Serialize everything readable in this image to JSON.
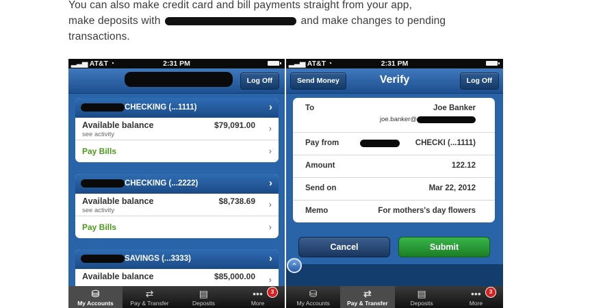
{
  "article": {
    "line1": "You can also make credit card and bill payments straight from your app,",
    "line2_before": "make deposits with",
    "line2_after": "and make changes to pending",
    "line3": "transactions."
  },
  "status_bar": {
    "carrier": "AT&T",
    "time": "2:31 PM"
  },
  "left_screen": {
    "logoff_label": "Log Off",
    "accounts": [
      {
        "name": "CHECKING (...1111)",
        "balance_label": "Available balance",
        "balance": "$79,091.00",
        "activity_label": "see activity",
        "pay_bills_label": "Pay Bills"
      },
      {
        "name": "CHECKING (...2222)",
        "balance_label": "Available balance",
        "balance": "$8,738.69",
        "activity_label": "see activity",
        "pay_bills_label": "Pay Bills"
      },
      {
        "name": "SAVINGS (...3333)",
        "balance_label": "Available balance",
        "balance": "$85,000.00"
      }
    ],
    "tabs": [
      {
        "label": "My Accounts",
        "active": true
      },
      {
        "label": "Pay & Transfer",
        "active": false
      },
      {
        "label": "Deposits",
        "active": false
      },
      {
        "label": "More",
        "active": false,
        "badge": "3"
      }
    ]
  },
  "right_screen": {
    "back_label": "Send Money",
    "title": "Verify",
    "logoff_label": "Log Off",
    "details": {
      "to_label": "To",
      "to_name": "Joe Banker",
      "to_email": "joe.banker@",
      "pay_from_label": "Pay from",
      "pay_from_value": "CHECKI (...1111)",
      "amount_label": "Amount",
      "amount_value": "122.12",
      "send_on_label": "Send on",
      "send_on_value": "Mar 22, 2012",
      "memo_label": "Memo",
      "memo_value": "For mothers's day flowers"
    },
    "cancel_label": "Cancel",
    "submit_label": "Submit",
    "tabs": [
      {
        "label": "My Accounts",
        "active": false
      },
      {
        "label": "Pay & Transfer",
        "active": true
      },
      {
        "label": "Deposits",
        "active": false
      },
      {
        "label": "More",
        "active": false,
        "badge": "3"
      }
    ]
  },
  "colors": {
    "nav_blue": "#1d4f8f",
    "submit_green": "#1b7e25",
    "pay_bills_green": "#4a9a1a",
    "badge_red": "#d72020"
  },
  "icons": [
    "wifi-icon",
    "battery-icon",
    "chevron-right-icon",
    "chevron-up-icon",
    "my-accounts-icon",
    "pay-transfer-icon",
    "deposits-icon",
    "more-icon"
  ]
}
